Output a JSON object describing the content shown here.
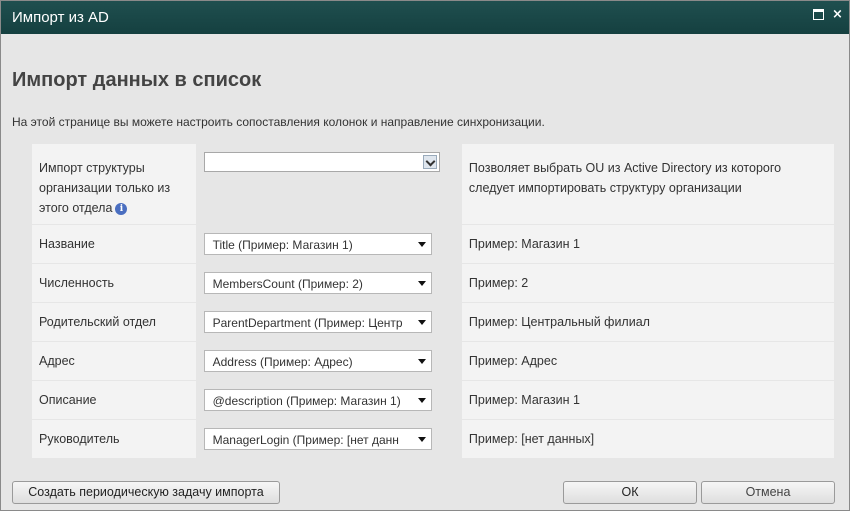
{
  "window": {
    "title": "Импорт из AD"
  },
  "page": {
    "heading": "Импорт данных в список",
    "description": "На этой странице вы можете настроить сопоставления колонок и направление синхронизации."
  },
  "org_row": {
    "label_line1": "Импорт структуры",
    "label_line2": "организации только из",
    "label_line3": "этого отдела",
    "select_value": "",
    "help_line1": "Позволяет выбрать OU из Active Directory из которого",
    "help_line2": "следует импортировать структуру организации",
    "info_icon": "info-icon"
  },
  "rows": [
    {
      "label": "Название",
      "value": "Title (Пример: Магазин 1)",
      "example": "Пример: Магазин 1"
    },
    {
      "label": "Численность",
      "value": "MembersCount (Пример: 2)",
      "example": "Пример: 2"
    },
    {
      "label": "Родительский отдел",
      "value": "ParentDepartment (Пример: Центр",
      "example": "Пример: Центральный филиал"
    },
    {
      "label": "Адрес",
      "value": "Address (Пример: Адрес)",
      "example": "Пример: Адрес"
    },
    {
      "label": "Описание",
      "value": "@description (Пример: Магазин 1)",
      "example": "Пример: Магазин 1"
    },
    {
      "label": "Руководитель",
      "value": "ManagerLogin (Пример: [нет данн",
      "example": "Пример: [нет данных]"
    }
  ],
  "buttons": {
    "create_task": "Создать периодическую задачу импорта",
    "ok": "ОК",
    "cancel": "Отмена"
  },
  "colors": {
    "titlebar": "#1f4f4f",
    "background": "#e6e6e6",
    "cell": "#f3f3f3"
  }
}
